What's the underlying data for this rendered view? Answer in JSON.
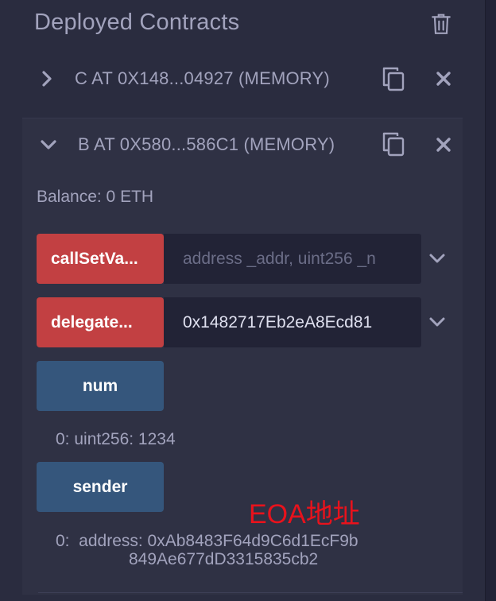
{
  "header": {
    "title": "Deployed Contracts"
  },
  "contracts": [
    {
      "label": "C AT 0X148...04927 (MEMORY)",
      "expanded": false
    },
    {
      "label": "B AT 0X580...586C1 (MEMORY)",
      "expanded": true,
      "balance": "Balance: 0 ETH",
      "functions": [
        {
          "name": "callSetVa...",
          "kind": "transact",
          "input_value": "",
          "input_placeholder": "address _addr, uint256 _n"
        },
        {
          "name": "delegate...",
          "kind": "transact",
          "input_value": "0x1482717Eb2eA8Ecd81",
          "input_placeholder": ""
        },
        {
          "name": "num",
          "kind": "call",
          "result": "0: uint256: 1234"
        },
        {
          "name": "sender",
          "kind": "call",
          "result_line1": "0:  address: 0xAb8483F64d9C6d1EcF9b",
          "result_line2": "849Ae677dD3315835cb2"
        }
      ]
    }
  ],
  "annotation": "EOA地址",
  "icons": {
    "trash": "trash-icon",
    "chevron_right": "chevron-right-icon",
    "chevron_down": "chevron-down-icon",
    "copy": "copy-icon",
    "close": "close-icon"
  },
  "colors": {
    "background": "#2a2c3f",
    "text": "#a2a3bd",
    "transact_button": "#c24042",
    "call_button": "#35567c",
    "input_bg": "#222336",
    "annotation": "#e8121c"
  }
}
